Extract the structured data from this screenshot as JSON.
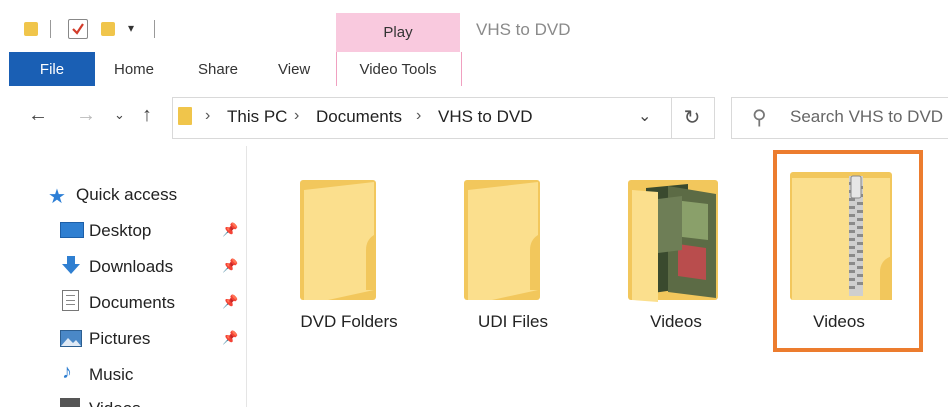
{
  "window": {
    "title": "VHS to DVD"
  },
  "contextual_tab": {
    "group_label": "Play",
    "tab_label": "Video Tools"
  },
  "ribbon": {
    "tabs": [
      "File",
      "Home",
      "Share",
      "View"
    ]
  },
  "address_bar": {
    "crumbs": [
      "This PC",
      "Documents",
      "VHS to DVD"
    ]
  },
  "search": {
    "placeholder": "Search VHS to DVD"
  },
  "sidebar": {
    "items": [
      {
        "label": "Quick access",
        "icon": "star-icon"
      },
      {
        "label": "Desktop",
        "icon": "desktop-icon",
        "pinned": true
      },
      {
        "label": "Downloads",
        "icon": "download-arrow-icon",
        "pinned": true
      },
      {
        "label": "Documents",
        "icon": "document-icon",
        "pinned": true
      },
      {
        "label": "Pictures",
        "icon": "pictures-icon",
        "pinned": true
      },
      {
        "label": "Music",
        "icon": "music-note-icon"
      },
      {
        "label": "Videos",
        "icon": "videos-icon"
      }
    ]
  },
  "files": [
    {
      "label": "DVD Folders",
      "type": "folder"
    },
    {
      "label": "UDI Files",
      "type": "folder"
    },
    {
      "label": "Videos",
      "type": "folder-with-images"
    },
    {
      "label": "Videos",
      "type": "zip-folder",
      "selected": true
    }
  ],
  "colors": {
    "file_tab": "#1a5fb4",
    "play_tab": "#f9c9de",
    "selection": "#ec7c2e",
    "folder": "#f2c75c"
  }
}
